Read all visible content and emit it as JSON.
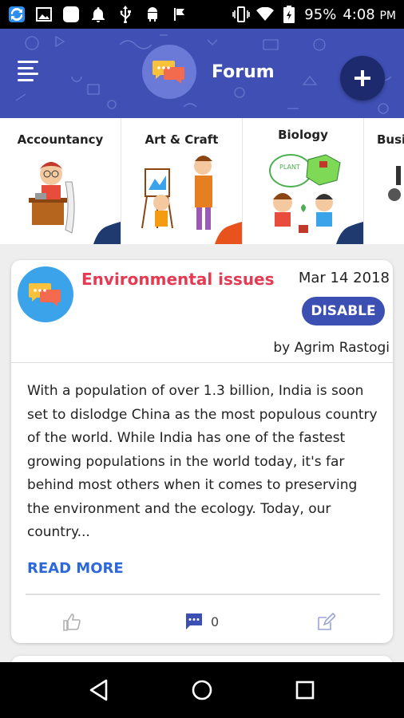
{
  "status_bar": {
    "battery": "95%",
    "time": "4:08",
    "ampm": "PM"
  },
  "header": {
    "title": "Forum",
    "bg_color": "#3f4fb3"
  },
  "categories": [
    {
      "label": "Accountancy",
      "accent": "#1e3a6e"
    },
    {
      "label": "Art & Craft",
      "accent": "#e8531d"
    },
    {
      "label": "Biology",
      "accent": "#1e3a6e"
    },
    {
      "label": "Busin",
      "accent": "#1e3a6e"
    }
  ],
  "post": {
    "title": "Environmental issues",
    "date": "Mar 14 2018",
    "disable_label": "DISABLE",
    "author": "by Agrim Rastogi",
    "body": "With a population of over 1.3 billion, India is soon set to dislodge China as the most populous country of the world. While India has one of the fastest growing populations in the world today, it's far behind most others when it comes to preserving the environment and the ecology. Today, our country...",
    "read_more": "READ MORE",
    "comment_count": "0",
    "title_color": "#e53a52",
    "link_color": "#2d68d8"
  },
  "nav": {
    "back": "back-icon",
    "home": "home-icon",
    "recents": "recents-icon"
  }
}
